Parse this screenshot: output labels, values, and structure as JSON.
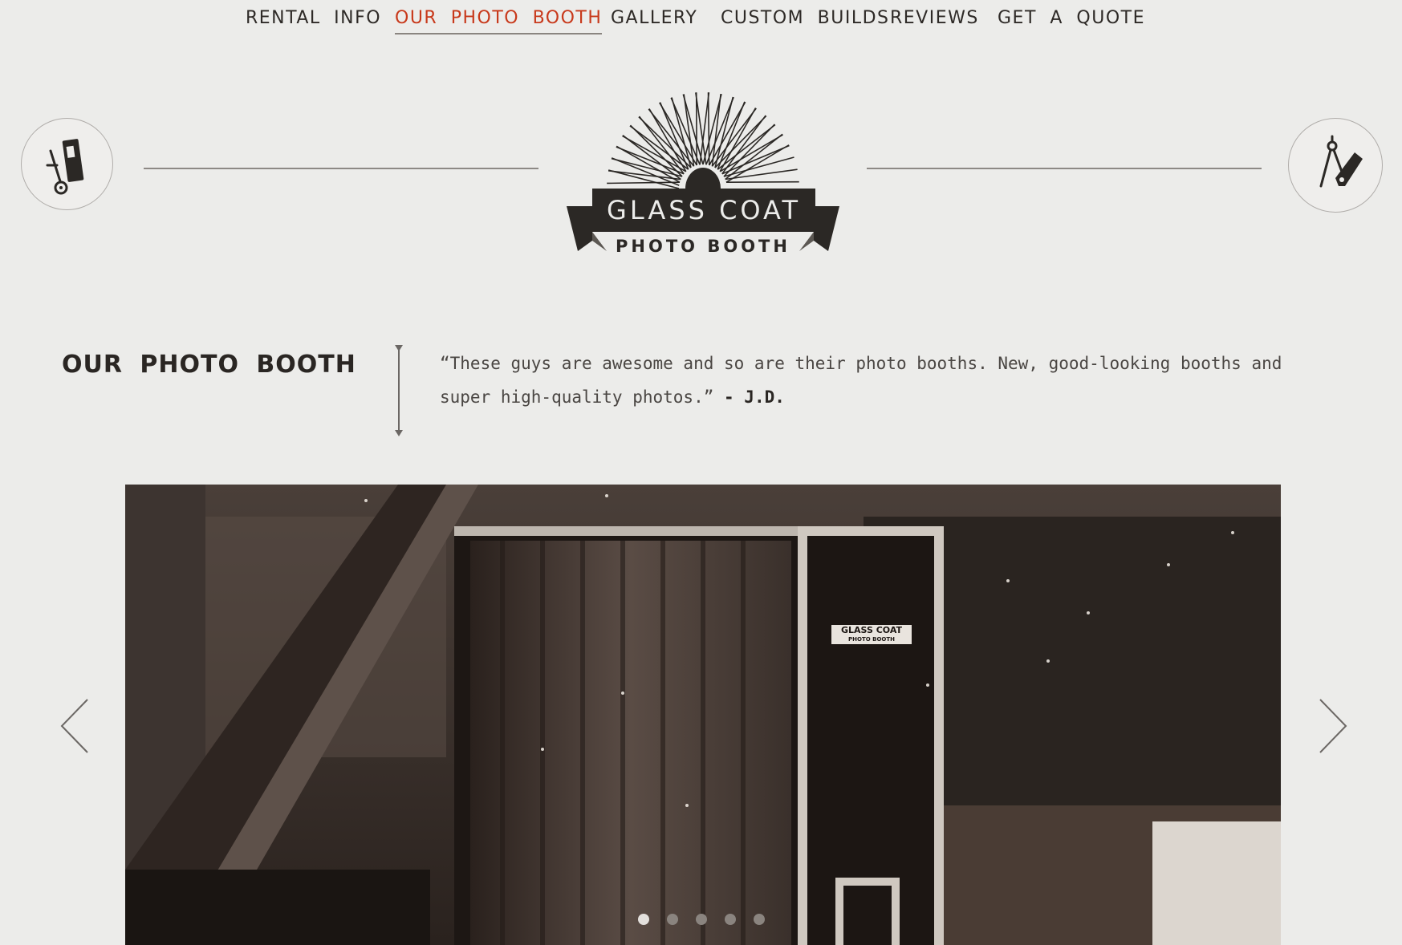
{
  "nav": {
    "items": [
      {
        "label": "Rental Info"
      },
      {
        "label": "Our Photo Booth",
        "active": true
      },
      {
        "label": "Gallery"
      },
      {
        "label": "Custom Builds"
      },
      {
        "label": "Reviews"
      },
      {
        "label": "Get a Quote"
      }
    ]
  },
  "logo": {
    "title": "GLASS COAT",
    "subtitle": "PHOTO BOOTH"
  },
  "side_icons": {
    "left": "hand-truck-icon",
    "right": "compass-saw-icon"
  },
  "section": {
    "title": "Our Photo Booth"
  },
  "quote": {
    "text": "“These guys are awesome and so are their photo booths. New, good-looking booths and super high-quality photos.”",
    "author": " - J.D."
  },
  "slider": {
    "booth_label": "GLASS COAT",
    "booth_sublabel": "PHOTO BOOTH",
    "prev_icon": "chevron-left-icon",
    "next_icon": "chevron-right-icon",
    "slide_count": 5,
    "active_slide": 1
  },
  "colors": {
    "background": "#ececea",
    "accent": "#c8391b",
    "text": "#2a2623"
  }
}
